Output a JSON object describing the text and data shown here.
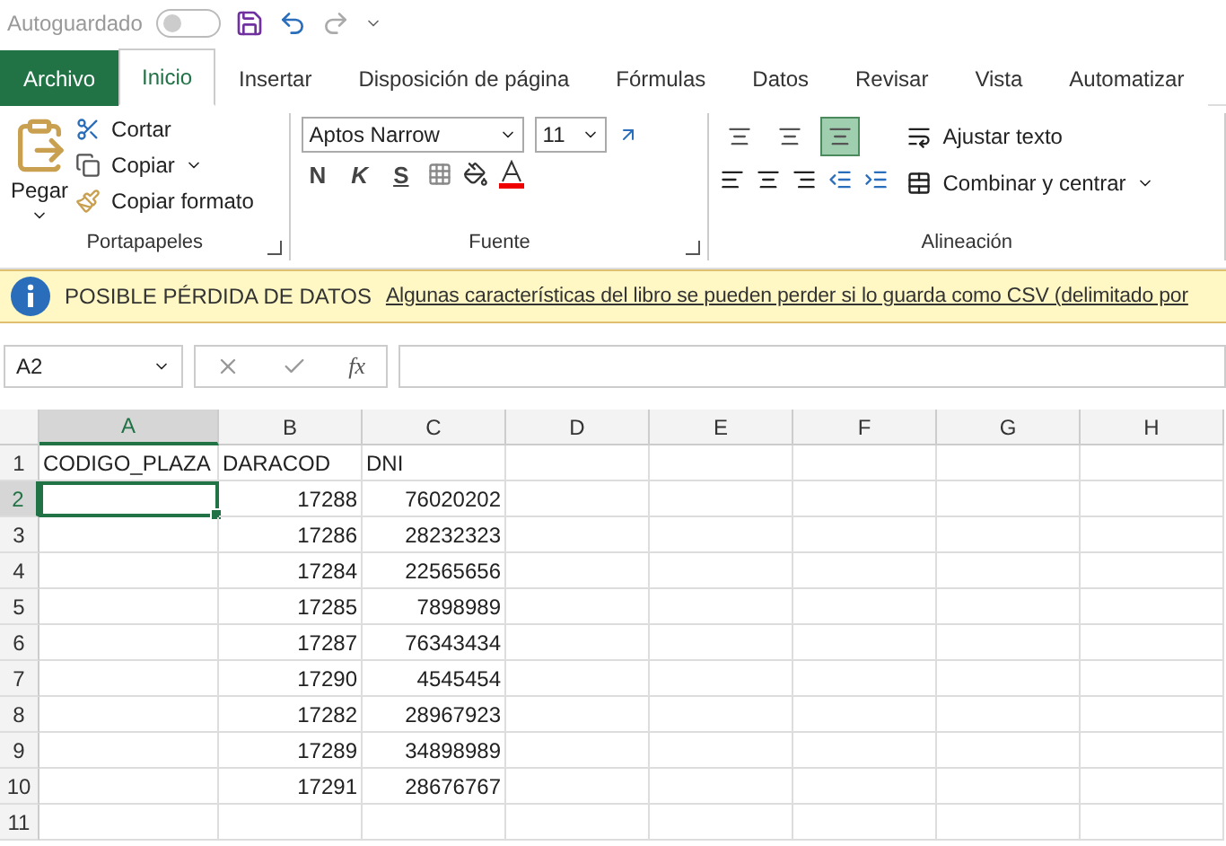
{
  "quick_access": {
    "autosave_label": "Autoguardado",
    "autosave_on": false
  },
  "tabs": [
    {
      "label": "Archivo",
      "kind": "file",
      "selected": false
    },
    {
      "label": "Inicio",
      "kind": "tab",
      "selected": true
    },
    {
      "label": "Insertar",
      "kind": "tab",
      "selected": false
    },
    {
      "label": "Disposición de página",
      "kind": "tab",
      "selected": false
    },
    {
      "label": "Fórmulas",
      "kind": "tab",
      "selected": false
    },
    {
      "label": "Datos",
      "kind": "tab",
      "selected": false
    },
    {
      "label": "Revisar",
      "kind": "tab",
      "selected": false
    },
    {
      "label": "Vista",
      "kind": "tab",
      "selected": false
    },
    {
      "label": "Automatizar",
      "kind": "tab",
      "selected": false
    }
  ],
  "clipboard": {
    "paste": "Pegar",
    "cut": "Cortar",
    "copy": "Copiar",
    "format_painter": "Copiar formato",
    "group": "Portapapeles"
  },
  "font": {
    "name": "Aptos Narrow",
    "size": "11",
    "bold": "N",
    "italic": "K",
    "underline": "S",
    "group": "Fuente"
  },
  "alignment": {
    "vertical": [
      {
        "selected": false
      },
      {
        "selected": false
      },
      {
        "selected": true
      }
    ],
    "wrap": "Ajustar texto",
    "merge": "Combinar y centrar",
    "group": "Alineación"
  },
  "info_bar": {
    "title": "POSIBLE PÉRDIDA DE DATOS",
    "message": "Algunas características del libro se pueden perder si lo guarda como CSV (delimitado por"
  },
  "name_box": "A2",
  "function_label": "fx",
  "columns": [
    {
      "label": "A",
      "selected": true
    },
    {
      "label": "B",
      "selected": false
    },
    {
      "label": "C",
      "selected": false
    },
    {
      "label": "D",
      "selected": false
    },
    {
      "label": "E",
      "selected": false
    },
    {
      "label": "F",
      "selected": false
    },
    {
      "label": "G",
      "selected": false
    },
    {
      "label": "H",
      "selected": false
    }
  ],
  "rows": [
    {
      "number": "1",
      "selected": false,
      "cells": [
        "CODIGO_PLAZA",
        "DARACOD",
        "DNI"
      ]
    },
    {
      "number": "2",
      "selected": true,
      "cells": [
        "",
        "17288",
        "76020202"
      ]
    },
    {
      "number": "3",
      "selected": false,
      "cells": [
        "",
        "17286",
        "28232323"
      ]
    },
    {
      "number": "4",
      "selected": false,
      "cells": [
        "",
        "17284",
        "22565656"
      ]
    },
    {
      "number": "5",
      "selected": false,
      "cells": [
        "",
        "17285",
        "7898989"
      ]
    },
    {
      "number": "6",
      "selected": false,
      "cells": [
        "",
        "17287",
        "76343434"
      ]
    },
    {
      "number": "7",
      "selected": false,
      "cells": [
        "",
        "17290",
        "4545454"
      ]
    },
    {
      "number": "8",
      "selected": false,
      "cells": [
        "",
        "17282",
        "28967923"
      ]
    },
    {
      "number": "9",
      "selected": false,
      "cells": [
        "",
        "17289",
        "34898989"
      ]
    },
    {
      "number": "10",
      "selected": false,
      "cells": [
        "",
        "17291",
        "28676767"
      ]
    },
    {
      "number": "11",
      "selected": false,
      "cells": [
        "",
        "",
        ""
      ]
    }
  ]
}
